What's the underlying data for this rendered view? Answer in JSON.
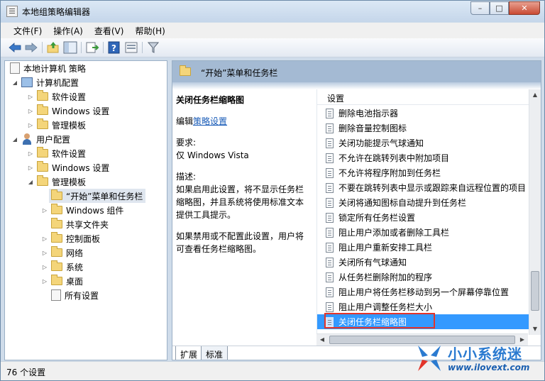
{
  "window": {
    "title": "本地组策略编辑器",
    "minimize_icon": "minimize-icon",
    "maximize_icon": "maximize-icon",
    "close_icon": "close-icon"
  },
  "menu": [
    "文件(F)",
    "操作(A)",
    "查看(V)",
    "帮助(H)"
  ],
  "toolbar_icons": [
    "back-arrow-icon",
    "forward-arrow-icon",
    "up-folder-icon",
    "show-hide-tree-icon",
    "export-list-icon",
    "help-icon",
    "properties-icon",
    "filter-icon"
  ],
  "tree": {
    "root": "本地计算机 策略",
    "computer_config": "计算机配置",
    "computer_software": "软件设置",
    "computer_windows": "Windows 设置",
    "computer_admin": "管理模板",
    "user_config": "用户配置",
    "user_software": "软件设置",
    "user_windows": "Windows 设置",
    "user_admin": "管理模板",
    "start_taskbar": "“开始”菜单和任务栏",
    "windows_components": "Windows 组件",
    "shared_folders": "共享文件夹",
    "control_panel": "控制面板",
    "network": "网络",
    "system": "系统",
    "desktop": "桌面",
    "all_settings": "所有设置"
  },
  "right_header": "“开始”菜单和任务栏",
  "description": {
    "title": "关闭任务栏缩略图",
    "edit_prefix": "编辑",
    "edit_link": "策略设置",
    "req_label": "要求:",
    "req_value": "仅 Windows Vista",
    "desc_label": "描述:",
    "desc_p1": "如果启用此设置，将不显示任务栏缩略图，并且系统将使用标准文本提供工具提示。",
    "desc_p2": "如果禁用或不配置此设置，用户将可查看任务栏缩略图。"
  },
  "list": {
    "header": "设置",
    "items": [
      "删除电池指示器",
      "删除音量控制图标",
      "关闭功能提示气球通知",
      "不允许在跳转列表中附加项目",
      "不允许将程序附加到任务栏",
      "不要在跳转列表中显示或跟踪来自远程位置的项目",
      "关闭将通知图标自动提升到任务栏",
      "锁定所有任务栏设置",
      "阻止用户添加或者删除工具栏",
      "阻止用户重新安排工具栏",
      "关闭所有气球通知",
      "从任务栏删除附加的程序",
      "阻止用户将任务栏移动到另一个屏幕停靠位置",
      "阻止用户调整任务栏大小",
      "关闭任务栏缩略图"
    ],
    "selected_index": 14
  },
  "tabs": [
    "扩展",
    "标准"
  ],
  "status": "76 个设置",
  "watermark": {
    "title": "小小系统迷",
    "url": "www.ilovext.com"
  },
  "colors": {
    "selection": "#3399ff",
    "highlight_outline": "#e2342a",
    "header_band": "#a4bad3",
    "link": "#1a5cb8"
  }
}
